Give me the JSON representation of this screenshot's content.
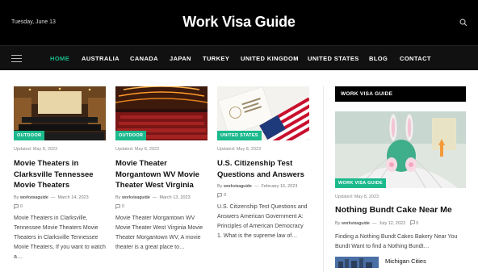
{
  "header": {
    "date": "Tuesday, June 13",
    "site_title": "Work Visa Guide"
  },
  "nav": {
    "items": [
      "HOME",
      "AUSTRALIA",
      "CANADA",
      "JAPAN",
      "TURKEY",
      "UNITED KINGDOM",
      "UNITED STATES",
      "BLOG",
      "CONTACT"
    ],
    "active": "HOME"
  },
  "colors": {
    "accent": "#1bb98c",
    "header_bg": "#000000"
  },
  "posts": [
    {
      "category": "OUTDOOR",
      "updated": "Updated:  May 8, 2023",
      "title": "Movie Theaters in Clarksville Tennessee Movie Theaters",
      "by": "By",
      "author": "workvisaguide",
      "date": "March 14, 2023",
      "comments": "0",
      "excerpt": "Movie Theaters in Clarksville, Tennessee Movie Theaters Movie Theaters in Clarksville Tennessee Movie Theaters, If you want to watch a…"
    },
    {
      "category": "OUTDOOR",
      "updated": "Updated:  May 8, 2023",
      "title": "Movie Theater Morgantown WV Movie Theater West Virginia",
      "by": "By",
      "author": "workvisaguide",
      "date": "March 13, 2023",
      "comments": "0",
      "excerpt": "Movie Theater Morgantown WV Movie Theater West Virginia Movie Theater Morgantown WV, A movie theater is a great place to…"
    },
    {
      "category": "UNITED STATES",
      "updated": "Updated:  May 8, 2023",
      "title": "U.S. Citizenship Test Questions and Answers",
      "by": "By",
      "author": "workvisaguide",
      "date": "February 16, 2023",
      "comments": "0",
      "excerpt": "U.S. Citizenship Test Questions and Answers American Government A: Principles of American Democracy 1. What is the supreme law of…"
    }
  ],
  "sidebar": {
    "widget_title": "WORK VISA GUIDE",
    "featured": {
      "category": "WORK VISA GUIDE",
      "updated": "Updated:  May 8, 2023",
      "title": "Nothing Bundt Cake Near Me",
      "by": "By",
      "author": "workvisaguide",
      "date": "July 12, 2022",
      "comments": "0",
      "excerpt": "Finding a Nothing Bundt Cakes Bakery Near You Bundt Want to find a Nothing Bundt…"
    },
    "next_title": "Michigan Cities"
  }
}
